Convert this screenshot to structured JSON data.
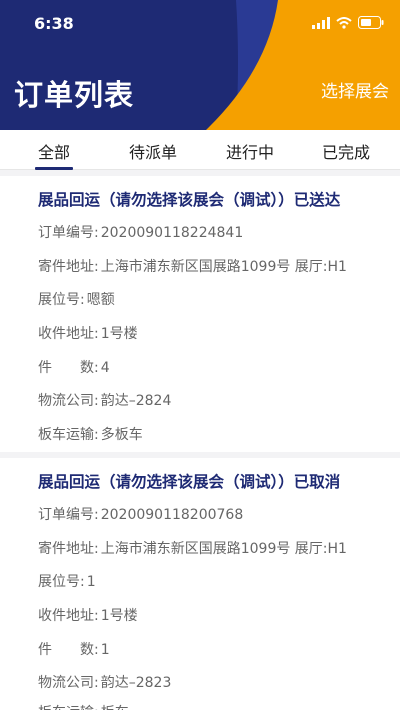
{
  "status_bar": {
    "time": "6:38"
  },
  "header": {
    "title": "订单列表",
    "select_expo_label": "选择展会"
  },
  "colors": {
    "navy": "#1e2a74",
    "orange": "#f5a000",
    "blue_stripe": "#2a3a94"
  },
  "tabs": [
    {
      "label": "全部",
      "active": true
    },
    {
      "label": "待派单",
      "active": false
    },
    {
      "label": "进行中",
      "active": false
    },
    {
      "label": "已完成",
      "active": false
    }
  ],
  "orders": [
    {
      "title": "展品回运（请勿选择该展会（调试））已送达",
      "fields": [
        {
          "label": "订单编号:",
          "value": "2020090118224841"
        },
        {
          "label": "寄件地址:",
          "value": "上海市浦东新区国展路1099号 展厅:H1"
        },
        {
          "label": "展位号:",
          "value": "嗯额"
        },
        {
          "label": "收件地址:",
          "value": "1号楼"
        },
        {
          "label": "件　　数:",
          "value": "4"
        },
        {
          "label": "物流公司:",
          "value": "韵达–2824"
        },
        {
          "label": "板车运输:",
          "value": "多板车"
        }
      ]
    },
    {
      "title": "展品回运（请勿选择该展会（调试））已取消",
      "fields": [
        {
          "label": "订单编号:",
          "value": "2020090118200768"
        },
        {
          "label": "寄件地址:",
          "value": "上海市浦东新区国展路1099号 展厅:H1"
        },
        {
          "label": "展位号:",
          "value": "1"
        },
        {
          "label": "收件地址:",
          "value": "1号楼"
        },
        {
          "label": "件　　数:",
          "value": "1"
        },
        {
          "label": "物流公司:",
          "value": "韵达–2823"
        },
        {
          "label": "板车运输:",
          "value": "板车"
        }
      ]
    }
  ]
}
